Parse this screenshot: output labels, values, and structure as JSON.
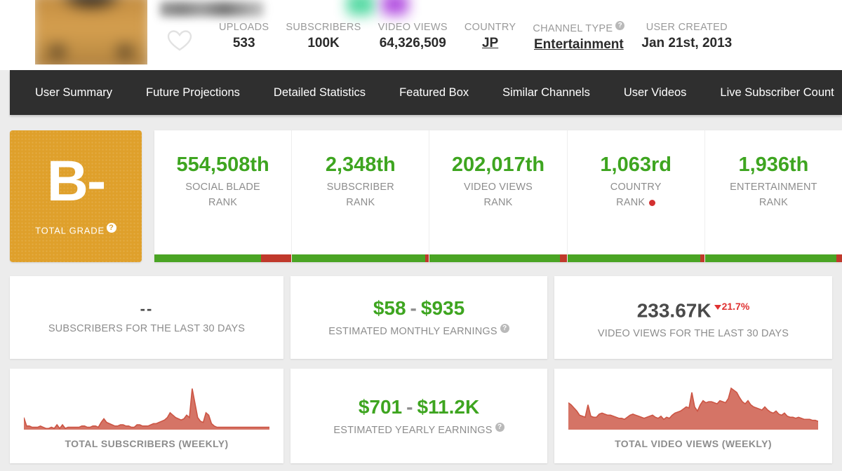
{
  "header": {
    "avatar_alt": "channel-avatar",
    "favorite_icon": "heart-icon",
    "stats": [
      {
        "label": "UPLOADS",
        "value": "533",
        "link": false,
        "help": false
      },
      {
        "label": "SUBSCRIBERS",
        "value": "100K",
        "link": false,
        "help": false
      },
      {
        "label": "VIDEO VIEWS",
        "value": "64,326,509",
        "link": false,
        "help": false
      },
      {
        "label": "COUNTRY",
        "value": "JP",
        "link": true,
        "help": false
      },
      {
        "label": "CHANNEL TYPE",
        "value": "Entertainment",
        "link": true,
        "help": true
      },
      {
        "label": "USER CREATED",
        "value": "Jan 21st, 2013",
        "link": false,
        "help": false
      }
    ],
    "help_glyph": "?"
  },
  "nav": {
    "items": [
      {
        "label": "User Summary"
      },
      {
        "label": "Future Projections"
      },
      {
        "label": "Detailed Statistics"
      },
      {
        "label": "Featured Box"
      },
      {
        "label": "Similar Channels"
      },
      {
        "label": "User Videos"
      },
      {
        "label": "Live Subscriber Count"
      }
    ]
  },
  "grade": {
    "letter": "B-",
    "label": "TOTAL GRADE",
    "help_glyph": "?",
    "color": "#dfa02b"
  },
  "ranks": [
    {
      "value": "554,508th",
      "label_line1": "SOCIAL BLADE",
      "label_line2": "RANK",
      "bar_green_pct": 78,
      "flag": false
    },
    {
      "value": "2,348th",
      "label_line1": "SUBSCRIBER",
      "label_line2": "RANK",
      "bar_green_pct": 97,
      "flag": false
    },
    {
      "value": "202,017th",
      "label_line1": "VIDEO VIEWS",
      "label_line2": "RANK",
      "bar_green_pct": 95,
      "flag": false
    },
    {
      "value": "1,063rd",
      "label_line1": "COUNTRY",
      "label_line2": "RANK",
      "bar_green_pct": 97,
      "flag": true
    },
    {
      "value": "1,936th",
      "label_line1": "ENTERTAINMENT",
      "label_line2": "RANK",
      "bar_green_pct": 96,
      "flag": false
    }
  ],
  "rank_colors": {
    "green": "#4aa424",
    "red": "#c0392b",
    "value": "#3ea520"
  },
  "cards": {
    "subs_30d": {
      "value": "--",
      "label": "SUBSCRIBERS FOR THE LAST 30 DAYS"
    },
    "monthly": {
      "low": "$58",
      "dash": "-",
      "high": "$935",
      "label": "ESTIMATED MONTHLY EARNINGS",
      "help_glyph": "?"
    },
    "views_30d": {
      "value": "233.67K",
      "delta": "21.7%",
      "delta_direction": "down",
      "delta_color": "#e03131",
      "label": "VIDEO VIEWS FOR THE LAST 30 DAYS"
    },
    "yearly": {
      "low": "$701",
      "dash": "-",
      "high": "$11.2K",
      "label": "ESTIMATED YEARLY EARNINGS",
      "help_glyph": "?"
    },
    "subs_chart_label": "TOTAL SUBSCRIBERS (WEEKLY)",
    "views_chart_label": "TOTAL VIDEO VIEWS (WEEKLY)"
  },
  "chart_data": [
    {
      "type": "area",
      "title": "TOTAL SUBSCRIBERS (WEEKLY)",
      "xlabel": "",
      "ylabel": "",
      "grid": false,
      "legend": "none",
      "series": [
        {
          "name": "Total Subscribers (weekly)",
          "color": "#cc5544",
          "values": [
            10,
            3,
            3,
            2,
            2,
            2,
            3,
            2,
            1,
            1,
            2,
            1,
            4,
            1,
            4,
            1,
            2,
            2,
            2,
            2,
            2,
            3,
            3,
            2,
            2,
            3,
            3,
            2,
            6,
            9,
            6,
            5,
            4,
            3,
            3,
            4,
            4,
            3,
            3,
            2,
            2,
            4,
            4,
            3,
            3,
            3,
            4,
            5,
            5,
            6,
            7,
            8,
            10,
            14,
            12,
            10,
            9,
            8,
            9,
            12,
            10,
            34,
            22,
            10,
            7,
            6,
            14,
            12,
            5,
            3,
            2,
            2,
            2,
            2,
            2,
            2,
            2,
            2,
            2,
            2,
            2,
            2,
            2,
            2,
            2,
            2,
            2,
            2,
            2,
            2
          ]
        }
      ],
      "ylim": [
        0,
        36
      ]
    },
    {
      "type": "area",
      "title": "TOTAL VIDEO VIEWS (WEEKLY)",
      "xlabel": "",
      "ylabel": "",
      "grid": false,
      "legend": "none",
      "series": [
        {
          "name": "Total Video Views (weekly)",
          "color": "#cc5544",
          "values": [
            26,
            24,
            21,
            18,
            14,
            13,
            12,
            24,
            13,
            12,
            12,
            15,
            16,
            15,
            14,
            14,
            13,
            12,
            11,
            11,
            10,
            12,
            14,
            15,
            14,
            13,
            12,
            11,
            12,
            13,
            14,
            12,
            11,
            13,
            10,
            12,
            11,
            14,
            16,
            17,
            18,
            20,
            22,
            21,
            36,
            22,
            18,
            24,
            28,
            26,
            27,
            27,
            26,
            25,
            28,
            27,
            26,
            30,
            40,
            38,
            36,
            31,
            27,
            25,
            28,
            24,
            22,
            21,
            20,
            19,
            22,
            19,
            17,
            16,
            18,
            15,
            14,
            16,
            13,
            12,
            12,
            11,
            12,
            11,
            10,
            10,
            10,
            9,
            9,
            8
          ]
        }
      ],
      "ylim": [
        0,
        42
      ]
    }
  ]
}
